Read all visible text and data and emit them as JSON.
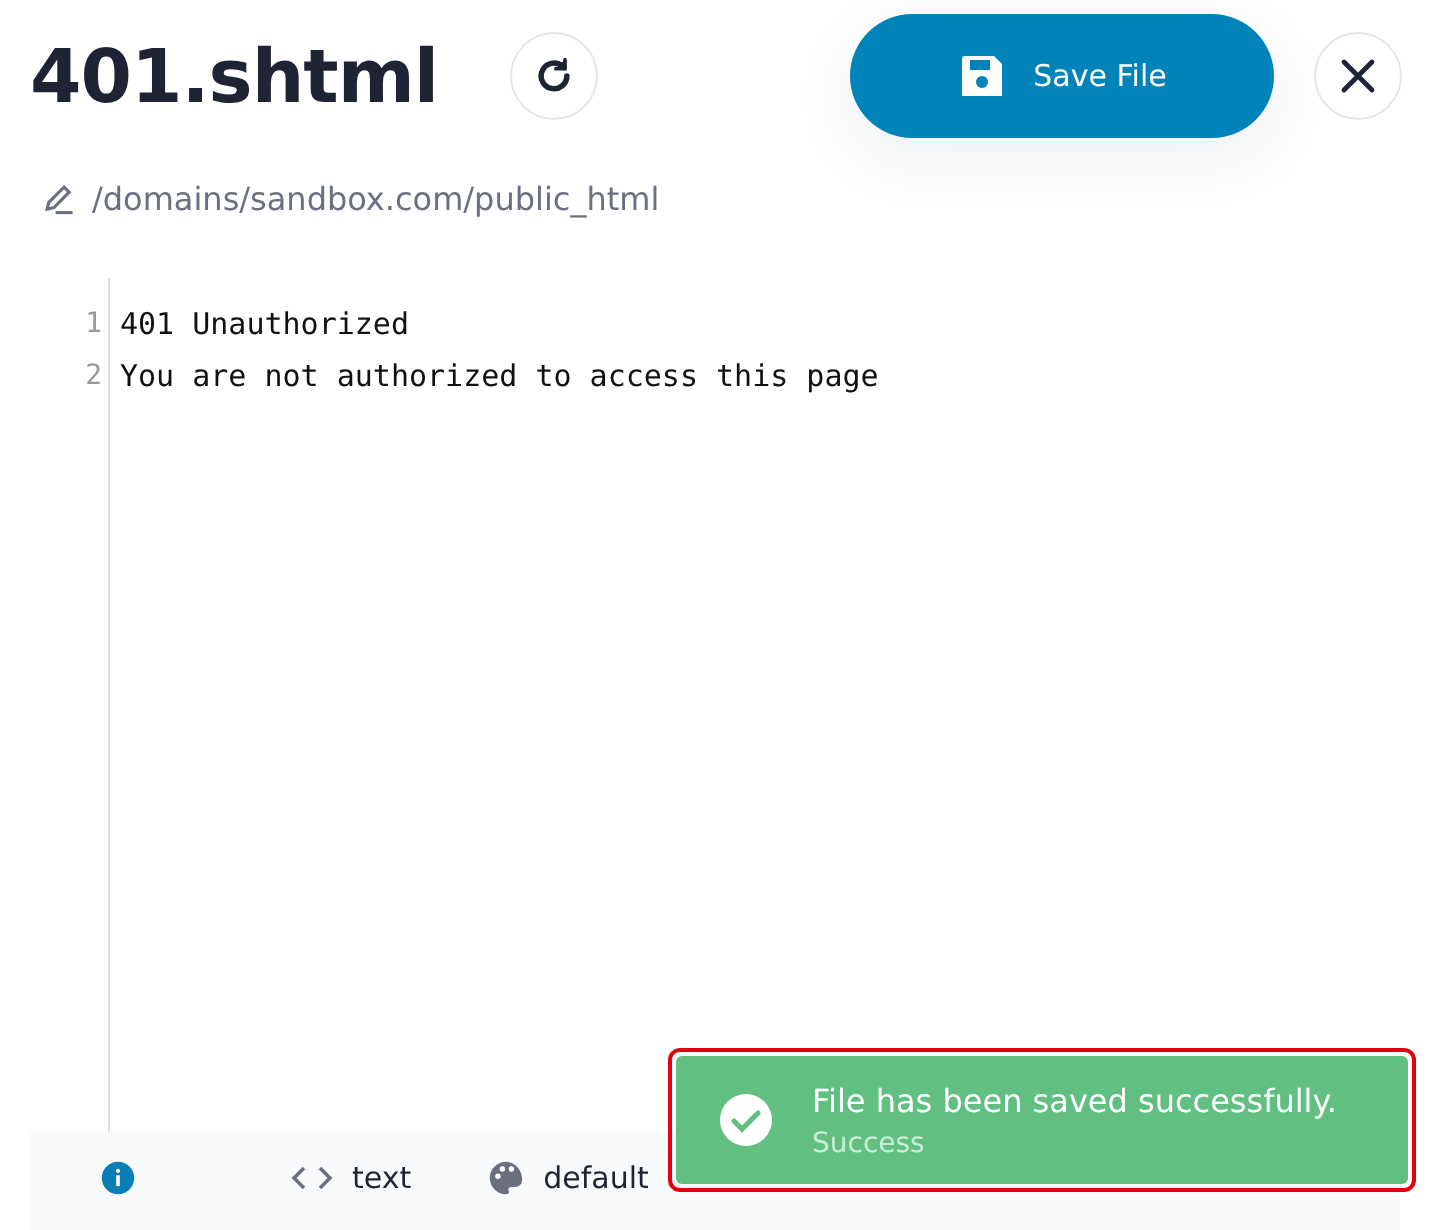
{
  "file": {
    "name": "401.shtml",
    "path": "/domains/sandbox.com/public_html"
  },
  "save_button": {
    "label": "Save File"
  },
  "editor": {
    "lines": [
      {
        "number": "1",
        "text": "401 Unauthorized"
      },
      {
        "number": "2",
        "text": "You are not authorized to access this page"
      }
    ]
  },
  "status_bar": {
    "mode": "text",
    "theme": "default"
  },
  "toast": {
    "message": "File has been saved successfully.",
    "status": "Success"
  }
}
